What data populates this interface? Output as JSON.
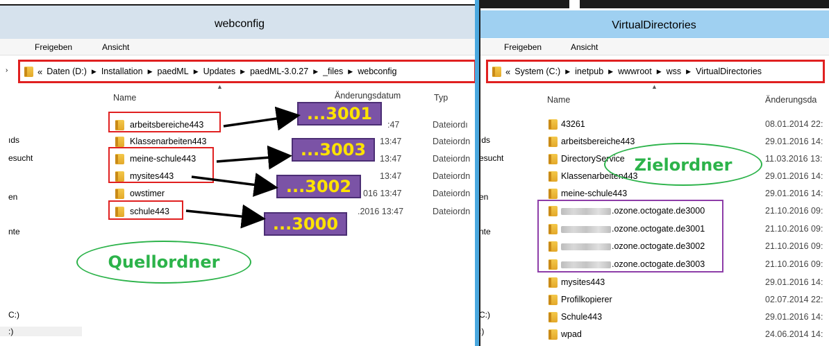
{
  "left": {
    "title": "webconfig",
    "ribbon": [
      "Freigeben",
      "Ansicht"
    ],
    "address": {
      "prefix": "«",
      "parts": [
        "Daten (D:)",
        "Installation",
        "paedML",
        "Updates",
        "paedML-3.0.27",
        "_files",
        "webconfig"
      ]
    },
    "nav": [
      "ıds",
      "esucht",
      "en",
      "nte",
      "C:)",
      ":)"
    ],
    "columns": {
      "name": "Name",
      "date": "Änderungsdatum",
      "type": "Typ"
    },
    "rows": [
      {
        "name": "arbeitsbereiche443",
        "date": ":47",
        "type": "Dateiordı"
      },
      {
        "name": "Klassenarbeiten443",
        "date": "13:47",
        "type": "Dateiordn"
      },
      {
        "name": "meine-schule443",
        "date": "13:47",
        "type": "Dateiordn"
      },
      {
        "name": "mysites443",
        "date": "13:47",
        "type": "Dateiordn"
      },
      {
        "name": "owstimer",
        "date": "016 13:47",
        "type": "Dateiordn"
      },
      {
        "name": "schule443",
        "date": ".2016 13:47",
        "type": "Dateiordn"
      }
    ],
    "badges": [
      "...3001",
      "...3003",
      "...3002",
      "...3000"
    ],
    "label": "Quellordner"
  },
  "right": {
    "title": "VirtualDirectories",
    "ribbon": [
      "Freigeben",
      "Ansicht"
    ],
    "address": {
      "prefix": "«",
      "parts": [
        "System (C:)",
        "inetpub",
        "wwwroot",
        "wss",
        "VirtualDirectories"
      ]
    },
    "nav": [
      "ıds",
      "esucht",
      "en",
      "nte",
      "C:)",
      ":)"
    ],
    "columns": {
      "name": "Name",
      "date": "Änderungsda"
    },
    "rows": [
      {
        "name": "43261",
        "date": "08.01.2014 22:"
      },
      {
        "name": "arbeitsbereiche443",
        "date": "29.01.2016 14:"
      },
      {
        "name": "DirectoryService",
        "date": "11.03.2016 13:"
      },
      {
        "name": "Klassenarbeiten443",
        "date": "29.01.2016 14:"
      },
      {
        "name": "meine-schule443",
        "date": "29.01.2016 14:"
      },
      {
        "name": ".ozone.octogate.de3000",
        "date": "21.10.2016 09:",
        "blur": true
      },
      {
        "name": ".ozone.octogate.de3001",
        "date": "21.10.2016 09:",
        "blur": true
      },
      {
        "name": ".ozone.octogate.de3002",
        "date": "21.10.2016 09:",
        "blur": true
      },
      {
        "name": ".ozone.octogate.de3003",
        "date": "21.10.2016 09:",
        "blur": true
      },
      {
        "name": "mysites443",
        "date": "29.01.2016 14:"
      },
      {
        "name": "Profilkopierer",
        "date": "02.07.2014 22:"
      },
      {
        "name": "Schule443",
        "date": "29.01.2016 14:"
      },
      {
        "name": "wpad",
        "date": "24.06.2014 14:"
      }
    ],
    "label": "Zielordner"
  },
  "colors": {
    "red_box": "#e02020",
    "purple_box": "#8d3da8",
    "badge_bg": "#7b53a6",
    "badge_text": "#ffe300",
    "ellipse": "#2cb34a",
    "divider": "#4aa8df"
  },
  "icons": {
    "folder": "folder-icon",
    "breadcrumb_separator": "chevron-right-icon",
    "sort": "sort-up-icon"
  }
}
